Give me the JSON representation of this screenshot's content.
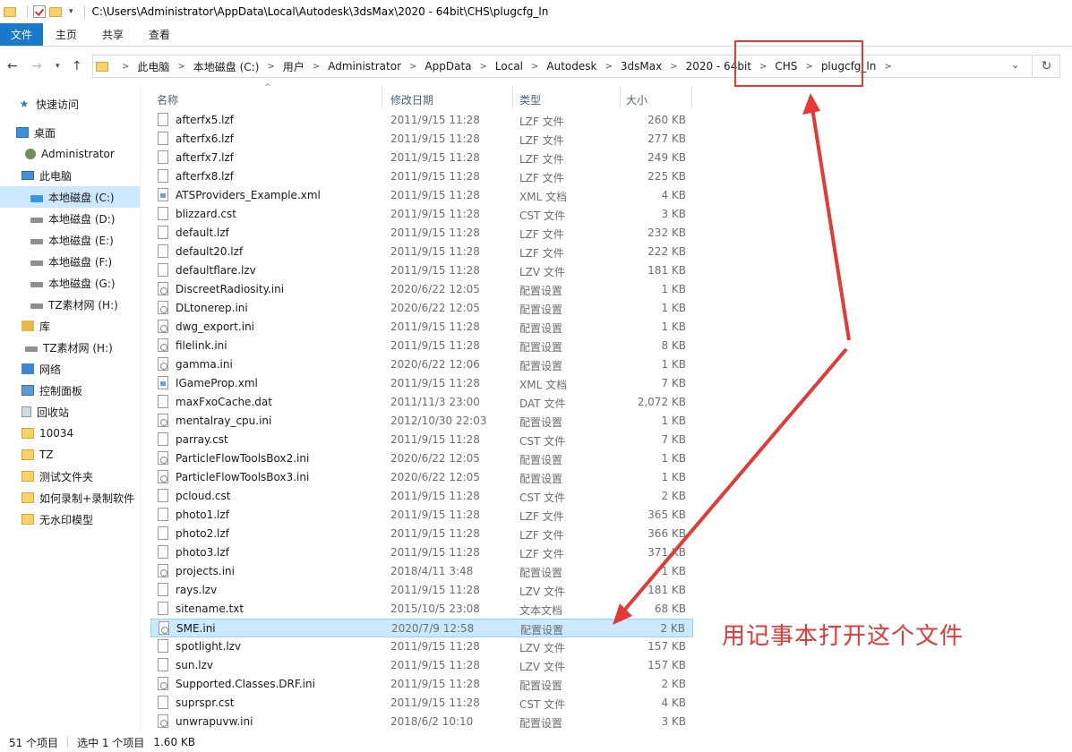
{
  "window": {
    "title_path": "C:\\Users\\Administrator\\AppData\\Local\\Autodesk\\3dsMax\\2020 - 64bit\\CHS\\plugcfg_ln"
  },
  "ribbon": {
    "tabs": [
      "文件",
      "主页",
      "共享",
      "查看"
    ]
  },
  "nav": {
    "back_icon": "arrow-left-icon",
    "forward_icon": "arrow-right-icon",
    "recent_icon": "chevron-down-icon",
    "up_icon": "arrow-up-icon",
    "refresh_icon": "refresh-icon"
  },
  "breadcrumb": [
    "此电脑",
    "本地磁盘 (C:)",
    "用户",
    "Administrator",
    "AppData",
    "Local",
    "Autodesk",
    "3dsMax",
    "2020 - 64bit",
    "CHS",
    "plugcfg_ln"
  ],
  "sidebar": {
    "items": [
      {
        "label": "快速访问",
        "icon": "star-icon"
      },
      {
        "label": "桌面",
        "icon": "desktop-icon"
      },
      {
        "label": "Administrator",
        "icon": "user-icon"
      },
      {
        "label": "此电脑",
        "icon": "computer-icon"
      },
      {
        "label": "本地磁盘 (C:)",
        "icon": "drive-icon"
      },
      {
        "label": "本地磁盘 (D:)",
        "icon": "drive-icon"
      },
      {
        "label": "本地磁盘 (E:)",
        "icon": "drive-icon"
      },
      {
        "label": "本地磁盘 (F:)",
        "icon": "drive-icon"
      },
      {
        "label": "本地磁盘 (G:)",
        "icon": "drive-icon"
      },
      {
        "label": "TZ素材网 (H:)",
        "icon": "drive-icon"
      },
      {
        "label": "库",
        "icon": "library-icon"
      },
      {
        "label": "TZ素材网 (H:)",
        "icon": "drive-icon"
      },
      {
        "label": "网络",
        "icon": "network-icon"
      },
      {
        "label": "控制面板",
        "icon": "control-panel-icon"
      },
      {
        "label": "回收站",
        "icon": "recycle-bin-icon"
      },
      {
        "label": "10034",
        "icon": "folder-icon"
      },
      {
        "label": "TZ",
        "icon": "folder-icon"
      },
      {
        "label": "测试文件夹",
        "icon": "folder-icon"
      },
      {
        "label": "如何录制+录制软件",
        "icon": "folder-icon"
      },
      {
        "label": "无水印模型",
        "icon": "folder-icon"
      }
    ]
  },
  "columns": {
    "name": "名称",
    "date": "修改日期",
    "type": "类型",
    "size": "大小"
  },
  "files": [
    {
      "name": "afterfx5.lzf",
      "date": "2011/9/15 11:28",
      "type": "LZF 文件",
      "size": "260 KB"
    },
    {
      "name": "afterfx6.lzf",
      "date": "2011/9/15 11:28",
      "type": "LZF 文件",
      "size": "277 KB"
    },
    {
      "name": "afterfx7.lzf",
      "date": "2011/9/15 11:28",
      "type": "LZF 文件",
      "size": "249 KB"
    },
    {
      "name": "afterfx8.lzf",
      "date": "2011/9/15 11:28",
      "type": "LZF 文件",
      "size": "225 KB"
    },
    {
      "name": "ATSProviders_Example.xml",
      "date": "2011/9/15 11:28",
      "type": "XML 文档",
      "size": "4 KB"
    },
    {
      "name": "blizzard.cst",
      "date": "2011/9/15 11:28",
      "type": "CST 文件",
      "size": "3 KB"
    },
    {
      "name": "default.lzf",
      "date": "2011/9/15 11:28",
      "type": "LZF 文件",
      "size": "232 KB"
    },
    {
      "name": "default20.lzf",
      "date": "2011/9/15 11:28",
      "type": "LZF 文件",
      "size": "222 KB"
    },
    {
      "name": "defaultflare.lzv",
      "date": "2011/9/15 11:28",
      "type": "LZV 文件",
      "size": "181 KB"
    },
    {
      "name": "DiscreetRadiosity.ini",
      "date": "2020/6/22 12:05",
      "type": "配置设置",
      "size": "1 KB"
    },
    {
      "name": "DLtonerep.ini",
      "date": "2020/6/22 12:05",
      "type": "配置设置",
      "size": "1 KB"
    },
    {
      "name": "dwg_export.ini",
      "date": "2011/9/15 11:28",
      "type": "配置设置",
      "size": "1 KB"
    },
    {
      "name": "filelink.ini",
      "date": "2011/9/15 11:28",
      "type": "配置设置",
      "size": "8 KB"
    },
    {
      "name": "gamma.ini",
      "date": "2020/6/22 12:06",
      "type": "配置设置",
      "size": "1 KB"
    },
    {
      "name": "IGameProp.xml",
      "date": "2011/9/15 11:28",
      "type": "XML 文档",
      "size": "7 KB"
    },
    {
      "name": "maxFxoCache.dat",
      "date": "2011/11/3 23:00",
      "type": "DAT 文件",
      "size": "2,072 KB"
    },
    {
      "name": "mentalray_cpu.ini",
      "date": "2012/10/30 22:03",
      "type": "配置设置",
      "size": "1 KB"
    },
    {
      "name": "parray.cst",
      "date": "2011/9/15 11:28",
      "type": "CST 文件",
      "size": "7 KB"
    },
    {
      "name": "ParticleFlowToolsBox2.ini",
      "date": "2020/6/22 12:05",
      "type": "配置设置",
      "size": "1 KB"
    },
    {
      "name": "ParticleFlowToolsBox3.ini",
      "date": "2020/6/22 12:05",
      "type": "配置设置",
      "size": "1 KB"
    },
    {
      "name": "pcloud.cst",
      "date": "2011/9/15 11:28",
      "type": "CST 文件",
      "size": "2 KB"
    },
    {
      "name": "photo1.lzf",
      "date": "2011/9/15 11:28",
      "type": "LZF 文件",
      "size": "365 KB"
    },
    {
      "name": "photo2.lzf",
      "date": "2011/9/15 11:28",
      "type": "LZF 文件",
      "size": "366 KB"
    },
    {
      "name": "photo3.lzf",
      "date": "2011/9/15 11:28",
      "type": "LZF 文件",
      "size": "371 KB"
    },
    {
      "name": "projects.ini",
      "date": "2018/4/11 3:48",
      "type": "配置设置",
      "size": "1 KB"
    },
    {
      "name": "rays.lzv",
      "date": "2011/9/15 11:28",
      "type": "LZV 文件",
      "size": "181 KB"
    },
    {
      "name": "sitename.txt",
      "date": "2015/10/5 23:08",
      "type": "文本文档",
      "size": "68 KB"
    },
    {
      "name": "SME.ini",
      "date": "2020/7/9 12:58",
      "type": "配置设置",
      "size": "2 KB"
    },
    {
      "name": "spotlight.lzv",
      "date": "2011/9/15 11:28",
      "type": "LZV 文件",
      "size": "157 KB"
    },
    {
      "name": "sun.lzv",
      "date": "2011/9/15 11:28",
      "type": "LZV 文件",
      "size": "157 KB"
    },
    {
      "name": "Supported.Classes.DRF.ini",
      "date": "2011/9/15 11:28",
      "type": "配置设置",
      "size": "2 KB"
    },
    {
      "name": "suprspr.cst",
      "date": "2011/9/15 11:28",
      "type": "CST 文件",
      "size": "4 KB"
    },
    {
      "name": "unwrapuvw.ini",
      "date": "2018/6/2 10:10",
      "type": "配置设置",
      "size": "3 KB"
    }
  ],
  "status": {
    "count": "51 个项目",
    "selected": "选中 1 个项目",
    "selected_size": "1.60 KB"
  },
  "annotation": {
    "text": "用记事本打开这个文件",
    "color": "#e53935"
  },
  "colors": {
    "accent": "#1979ca",
    "selection": "#cce8ff",
    "annotation": "#e53935"
  }
}
